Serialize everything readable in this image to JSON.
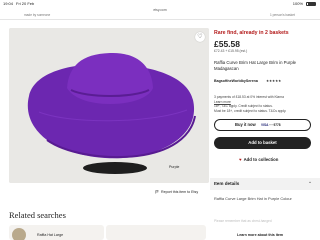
{
  "status_bar": {
    "time": "19:04",
    "date": "Fri 20 Feb",
    "signal": "100%"
  },
  "browser": {
    "url": "etsy.com"
  },
  "top_strip": {
    "left": "made by someone",
    "right": "1 person's basket"
  },
  "product": {
    "urgency": "Rare find, already in 2 baskets",
    "price": "£55.58",
    "old_price": "£72.43 + £15.95 (est.)",
    "title": "Raffia Curve Brim Hat Large Brim in Purple Madagascan",
    "shop": "BagsoftheWorldbySerena",
    "stars": "★★★★★",
    "klarna_text": "3 payments of £18.53 at 0% interest with Klarna",
    "klarna_learn": "Learn more",
    "klarna_extra": "18+, T&C apply. Credit subject to status.",
    "klarna_extra2": "Must be 18+, credit subject to status. T&Cs apply.",
    "image_caption": "Purple",
    "report_link": "Report this item to Etsy"
  },
  "actions": {
    "buy_it_now": "Buy it now",
    "pay_visa": "VISA",
    "pay_card": "····9778",
    "add_to_basket": "Add to basket",
    "add_to_collection": "Add to collection"
  },
  "item_details": {
    "header": "Item details",
    "description": "Raffia Curve Large Brim Hat in Purple Colour",
    "faded_text": "Please remember that as chest-hanged",
    "learn_more": "Learn more about this item"
  },
  "related": {
    "heading": "Related searches",
    "items": [
      {
        "label": "Raffia Hat Large"
      }
    ]
  },
  "colors": {
    "accent_red": "#b31b1b",
    "hat_purple": "#7b2fbf",
    "button_dark": "#222222"
  }
}
